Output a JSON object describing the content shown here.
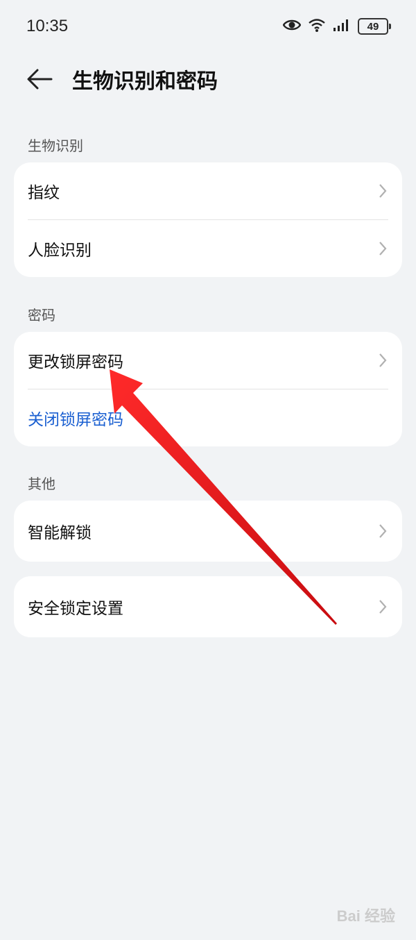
{
  "status_bar": {
    "time": "10:35",
    "battery": "49",
    "icons": [
      "eye-icon",
      "wifi-icon",
      "signal-icon",
      "battery-icon"
    ]
  },
  "header": {
    "title": "生物识别和密码",
    "back_icon": "back-arrow-icon"
  },
  "sections": [
    {
      "label": "生物识别",
      "items": [
        {
          "label": "指纹",
          "chevron": true
        },
        {
          "label": "人脸识别",
          "chevron": true
        }
      ]
    },
    {
      "label": "密码",
      "items": [
        {
          "label": "更改锁屏密码",
          "chevron": true
        },
        {
          "label": "关闭锁屏密码",
          "chevron": false,
          "color": "#1a5fd1"
        }
      ]
    },
    {
      "label": "其他",
      "items": [
        {
          "label": "智能解锁",
          "chevron": true
        }
      ]
    },
    {
      "label": "",
      "items": [
        {
          "label": "安全锁定设置",
          "chevron": true
        }
      ]
    }
  ],
  "annotation": {
    "color": "#e8141b"
  },
  "watermark": {
    "text": "Bai 经验"
  }
}
